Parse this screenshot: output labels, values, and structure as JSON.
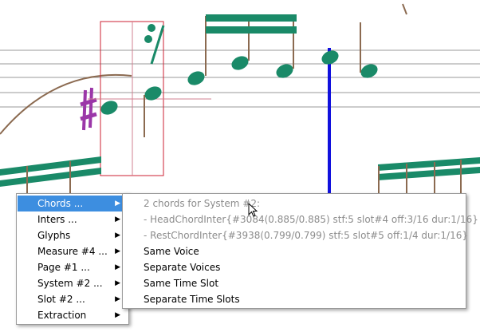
{
  "colors": {
    "note": "#1a8a68",
    "sharp": "#9b37a8",
    "stem": "#8b6a50",
    "barline": "#1111dd",
    "selection_box": "#cc2233",
    "menu_highlight": "#3d8ee0",
    "disabled_text": "#8c8c8c"
  },
  "menu": {
    "items": [
      {
        "label": "Chords ...",
        "selected": true
      },
      {
        "label": "Inters ..."
      },
      {
        "label": "Glyphs"
      },
      {
        "label": "Measure #4 ..."
      },
      {
        "label": "Page #1 ..."
      },
      {
        "label": "System #2 ..."
      },
      {
        "label": "Slot #2 ..."
      },
      {
        "label": "Extraction"
      }
    ],
    "arrow_icon": "chevron-right-icon"
  },
  "submenu": {
    "header": "2 chords for System #2:",
    "info_items": [
      "- HeadChordInter{#3084(0.885/0.885) stf:5 slot#4 off:3/16 dur:1/16}",
      "- RestChordInter{#3938(0.799/0.799) stf:5 slot#5 off:1/4 dur:1/16}"
    ],
    "actions": [
      "Same Voice",
      "Separate Voices",
      "Same Time Slot",
      "Separate Time Slots"
    ]
  }
}
